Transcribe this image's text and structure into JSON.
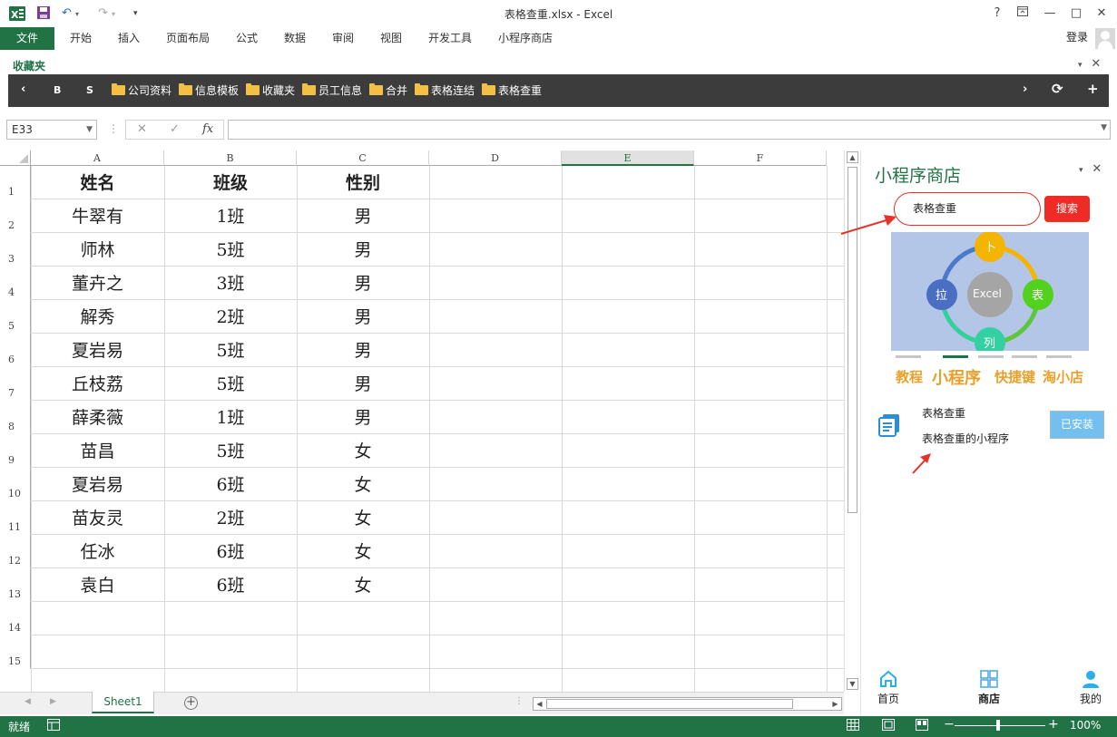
{
  "window": {
    "title": "表格查重.xlsx - Excel",
    "help": "?",
    "minimize": "—",
    "maximize": "□",
    "close": "✕"
  },
  "ribbon": {
    "file_tab": "文件",
    "tabs": [
      "开始",
      "插入",
      "页面布局",
      "公式",
      "数据",
      "审阅",
      "视图",
      "开发工具",
      "小程序商店"
    ],
    "login": "登录"
  },
  "favorites": {
    "pane_title": "收藏夹",
    "nav_prev": "‹",
    "btn_b": "B",
    "btn_s": "S",
    "folders": [
      "公司资料",
      "信息模板",
      "收藏夹",
      "员工信息",
      "合并",
      "表格连结",
      "表格查重"
    ],
    "nav_next": "›",
    "refresh": "⟳",
    "add": "+"
  },
  "formula_bar": {
    "name_box": "E33",
    "fx": "fx",
    "formula": ""
  },
  "grid": {
    "columns": [
      "A",
      "B",
      "C",
      "D",
      "E",
      "F"
    ],
    "selected_column": "E",
    "row_numbers": [
      "1",
      "2",
      "3",
      "4",
      "5",
      "6",
      "7",
      "8",
      "9",
      "10",
      "11",
      "12",
      "13",
      "14",
      "15"
    ],
    "rows": [
      [
        "姓名",
        "班级",
        "性别"
      ],
      [
        "牛翠有",
        "1班",
        "男"
      ],
      [
        "师林",
        "5班",
        "男"
      ],
      [
        "董卉之",
        "3班",
        "男"
      ],
      [
        "解秀",
        "2班",
        "男"
      ],
      [
        "夏岩易",
        "5班",
        "男"
      ],
      [
        "丘枝荔",
        "5班",
        "男"
      ],
      [
        "薛柔薇",
        "1班",
        "男"
      ],
      [
        "苗昌",
        "5班",
        "女"
      ],
      [
        "夏岩易",
        "6班",
        "女"
      ],
      [
        "苗友灵",
        "2班",
        "女"
      ],
      [
        "任冰",
        "6班",
        "女"
      ],
      [
        "袁白",
        "6班",
        "女"
      ]
    ]
  },
  "sheets": {
    "tabs": [
      "Sheet1"
    ],
    "add": "+"
  },
  "status": {
    "ready": "就绪",
    "zoom": "100%",
    "zoom_minus": "−",
    "zoom_plus": "+"
  },
  "side_panel": {
    "title": "小程序商店",
    "search_value": "表格查重",
    "search_button": "搜索",
    "banner": {
      "center": "Excel",
      "top": "卜",
      "left": "拉",
      "right": "表",
      "bottom": "列"
    },
    "categories": [
      "教程",
      "小程序",
      "快捷键",
      "淘小店"
    ],
    "result": {
      "name": "表格查重",
      "description": "表格查重的小程序",
      "install_button": "已安装"
    },
    "bottom_tabs": [
      "首页",
      "商店",
      "我的"
    ]
  },
  "colors": {
    "excel_green": "#217346",
    "search_red": "#ef2b25",
    "category_orange": "#e7a12b",
    "installed_blue": "#72bff0",
    "banner_blue": "#b3c6e7"
  }
}
